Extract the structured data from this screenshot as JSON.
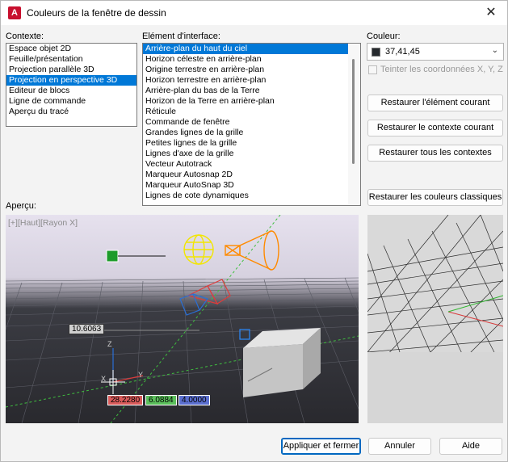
{
  "window": {
    "title": "Couleurs de la fenêtre de dessin",
    "app_icon_letter": "A",
    "close_glyph": "✕"
  },
  "context": {
    "label": "Contexte:",
    "items": [
      "Espace objet 2D",
      "Feuille/présentation",
      "Projection parallèle 3D",
      "Projection en perspective 3D",
      "Editeur de blocs",
      "Ligne de commande",
      "Aperçu du tracé"
    ],
    "selected_index": 3
  },
  "interface": {
    "label": "Elément d'interface:",
    "items": [
      "Arrière-plan du haut du ciel",
      "Horizon céleste en arrière-plan",
      "Origine terrestre en arrière-plan",
      "Horizon terrestre en arrière-plan",
      "Arrière-plan du bas de la Terre",
      "Horizon de la Terre en arrière-plan",
      "Réticule",
      "Commande de fenêtre",
      "Grandes lignes de la grille",
      "Petites lignes de la grille",
      "Lignes d'axe de la grille",
      "Vecteur Autotrack",
      "Marqueur Autosnap 2D",
      "Marqueur AutoSnap 3D",
      "Lignes de cote dynamiques"
    ],
    "selected_index": 0
  },
  "color": {
    "label": "Couleur:",
    "value": "37,41,45",
    "swatch": "#25292d",
    "tint_label": "Teinter les coordonnées X, Y, Z"
  },
  "buttons": {
    "restore_element": "Restaurer l'élément courant",
    "restore_context": "Restaurer le contexte courant",
    "restore_all": "Restaurer tous les contextes",
    "restore_classic": "Restaurer les couleurs classiques",
    "apply_close": "Appliquer et fermer",
    "cancel": "Annuler",
    "help": "Aide"
  },
  "preview": {
    "label": "Aperçu:",
    "viewport_label": "[+][Haut][Rayon X]",
    "dim_value": "10.6063",
    "coord_x": "28.2280",
    "coord_y": "6.0884",
    "coord_z": "4.0000",
    "axis_z": "Z",
    "axis_y": "Y",
    "axis_x": "X"
  }
}
